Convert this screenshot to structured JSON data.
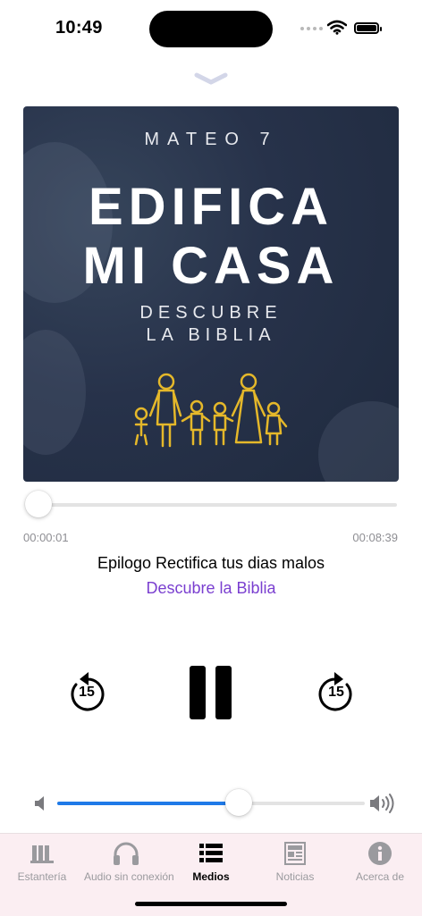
{
  "status": {
    "time": "10:49"
  },
  "artwork": {
    "series": "MATEO 7",
    "title_line1": "EDIFICA",
    "title_line2": "MI CASA",
    "subtitle_line1": "DESCUBRE",
    "subtitle_line2": "LA BIBLIA"
  },
  "player": {
    "elapsed": "00:00:01",
    "total": "00:08:39",
    "progress_fraction": 0.002,
    "track_title": "Epilogo Rectifica tus dias malos",
    "artist": "Descubre la Biblia",
    "skip_back_seconds": "15",
    "skip_forward_seconds": "15",
    "state": "playing",
    "volume_fraction": 0.6
  },
  "colors": {
    "accent_purple": "#7a3fd0",
    "volume_blue": "#1f7ae8",
    "artwork_bg": "#27324a",
    "artwork_gold": "#e5b82a",
    "tabbar_bg": "#fbeef2"
  },
  "tabs": [
    {
      "label": "Estantería",
      "icon": "bookshelf-icon",
      "active": false
    },
    {
      "label": "Audio sin conexión",
      "icon": "headphones-icon",
      "active": false
    },
    {
      "label": "Medios",
      "icon": "list-icon",
      "active": true
    },
    {
      "label": "Noticias",
      "icon": "newspaper-icon",
      "active": false
    },
    {
      "label": "Acerca de",
      "icon": "info-icon",
      "active": false
    }
  ]
}
